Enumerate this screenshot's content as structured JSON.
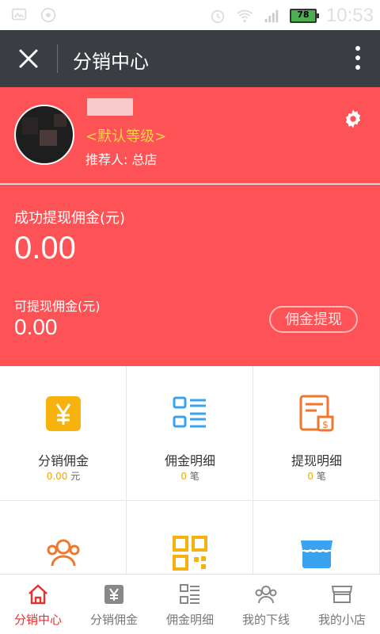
{
  "status_bar": {
    "battery": "78",
    "time": "10:53"
  },
  "header": {
    "title": "分销中心"
  },
  "profile": {
    "level": "<默认等级>",
    "referrer": "推荐人: 总店"
  },
  "commission": {
    "withdrawn_label": "成功提现佣金(元)",
    "withdrawn_value": "0.00",
    "available_label": "可提现佣金(元)",
    "available_value": "0.00",
    "withdraw_button": "佣金提现"
  },
  "grid": [
    {
      "label": "分销佣金",
      "value": "0.00",
      "unit": "元",
      "icon": "yuan-icon",
      "color": "#f7b20d"
    },
    {
      "label": "佣金明细",
      "value": "0",
      "unit": "笔",
      "icon": "list-icon",
      "color": "#3aa3f0"
    },
    {
      "label": "提现明细",
      "value": "0",
      "unit": "笔",
      "icon": "receipt-icon",
      "color": "#f0772d"
    },
    {
      "label": "",
      "icon": "team-icon",
      "color": "#f0772d"
    },
    {
      "label": "",
      "icon": "qrcode-icon",
      "color": "#f7b20d"
    },
    {
      "label": "",
      "icon": "store-icon",
      "color": "#3aa3f0"
    }
  ],
  "bottom_nav": [
    {
      "label": "分销中心",
      "icon": "home-icon",
      "active": true
    },
    {
      "label": "分销佣金",
      "icon": "yuan-icon",
      "active": false
    },
    {
      "label": "佣金明细",
      "icon": "list-icon",
      "active": false
    },
    {
      "label": "我的下线",
      "icon": "team-icon",
      "active": false
    },
    {
      "label": "我的小店",
      "icon": "store-icon",
      "active": false
    }
  ],
  "colors": {
    "accent_red": "#fd5256",
    "header_dark": "#3a3d42",
    "nav_active": "#e8312f",
    "level_yellow": "#ffd44a"
  }
}
